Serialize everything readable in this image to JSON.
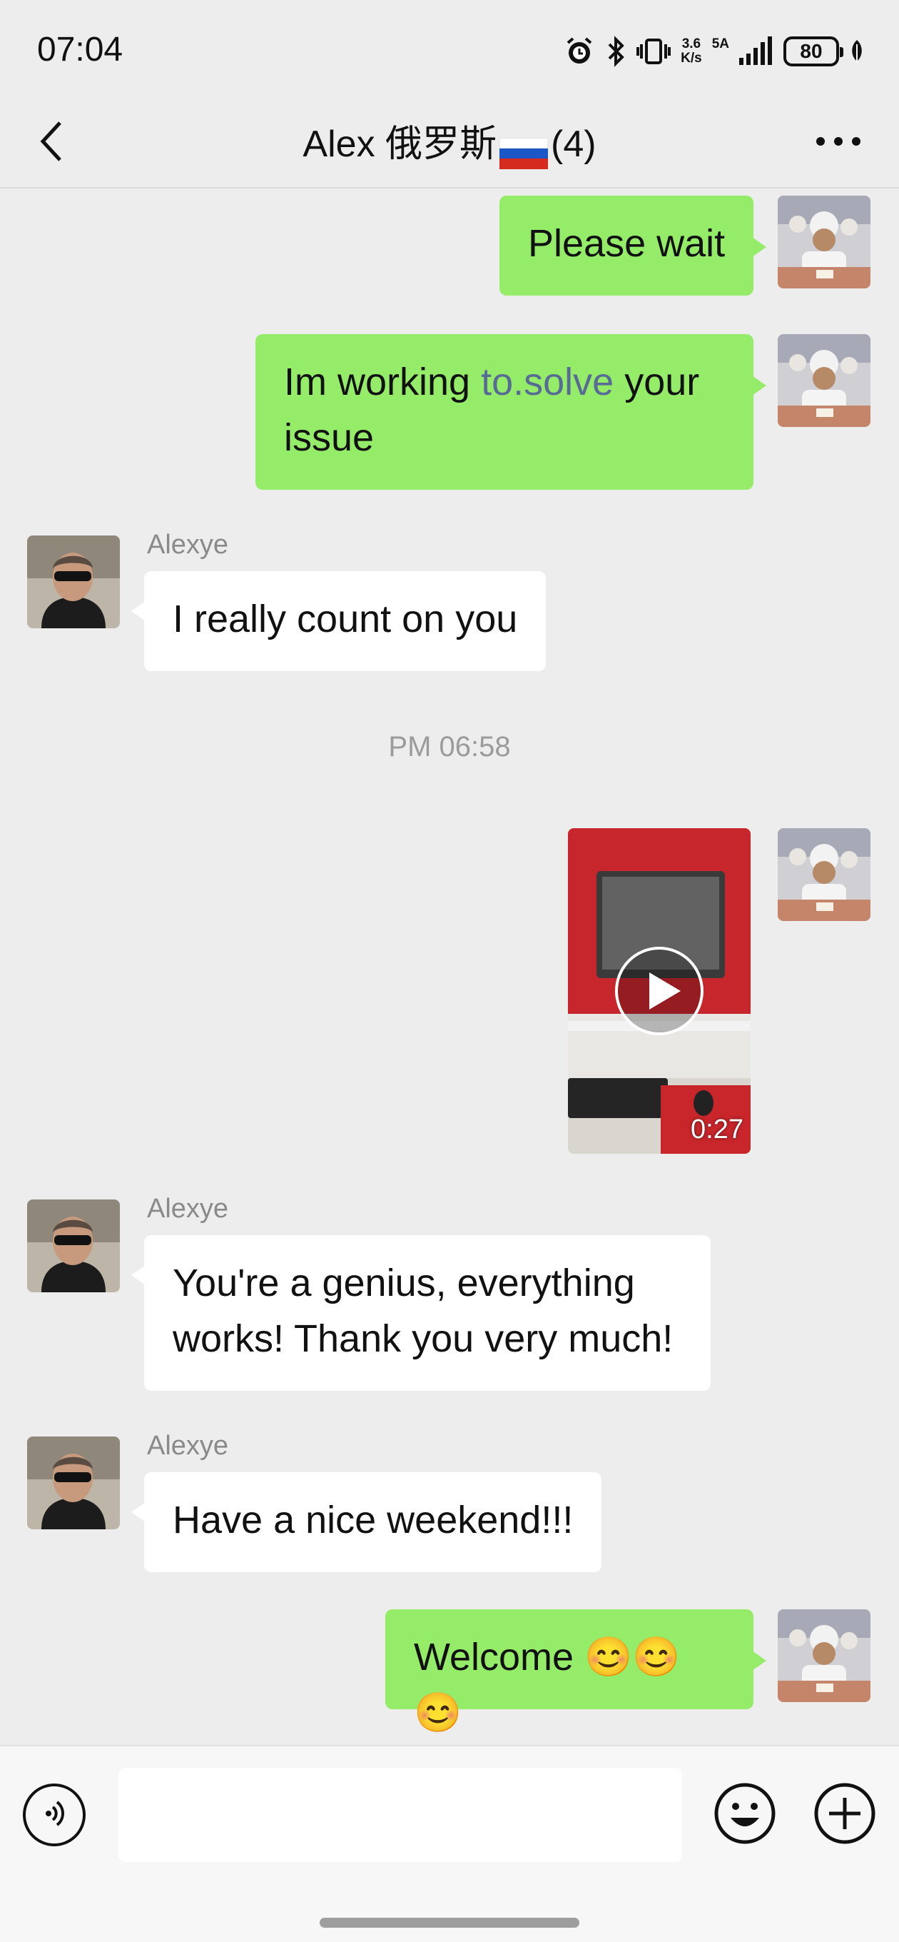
{
  "status_bar": {
    "time": "07:04",
    "net_speed_value": "3.6",
    "net_speed_unit": "K/s",
    "network": "5A",
    "battery": "80"
  },
  "header": {
    "title": "Alex 俄罗斯",
    "count": "(4)"
  },
  "messages": [
    {
      "from": "me",
      "text": "Please wait"
    },
    {
      "from": "me",
      "text_before": "Im working ",
      "link": "to.solve",
      "text_after": " your issue"
    },
    {
      "from": "them",
      "sender": "Alexye",
      "text": "I really count on you"
    },
    {
      "type": "timestamp",
      "text": "PM 06:58"
    },
    {
      "from": "me",
      "type": "video",
      "duration": "0:27"
    },
    {
      "from": "them",
      "sender": "Alexye",
      "text": "You're a genius, everything works! Thank you very much!"
    },
    {
      "from": "them",
      "sender": "Alexye",
      "text": "Have a nice weekend!!!"
    },
    {
      "from": "me",
      "text": "Welcome 😊😊😊"
    }
  ],
  "input": {
    "placeholder": ""
  },
  "colors": {
    "background": "#ededed",
    "my_bubble": "#95ec69",
    "their_bubble": "#ffffff",
    "link": "#576b95"
  },
  "icons": [
    "back-arrow-icon",
    "more-icon",
    "voice-icon",
    "emoji-icon",
    "add-icon",
    "play-icon",
    "alarm-icon",
    "bluetooth-icon",
    "vibrate-icon",
    "signal-icon",
    "leaf-icon"
  ]
}
